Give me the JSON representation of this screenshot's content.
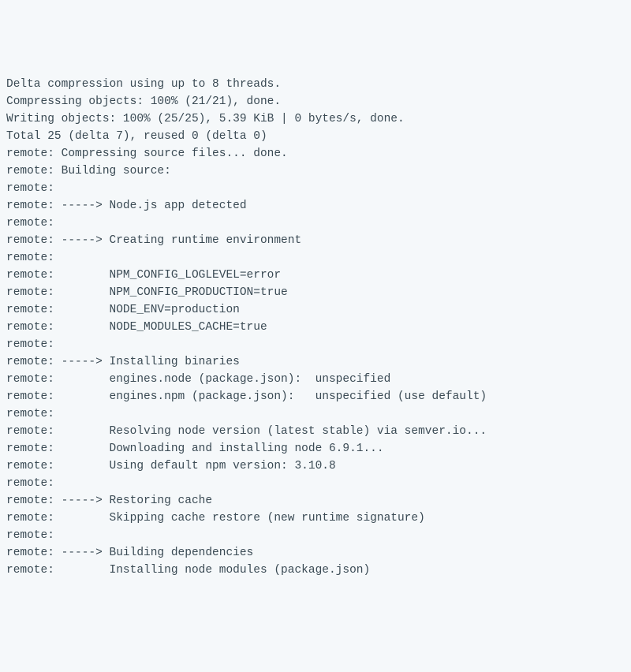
{
  "terminal": {
    "lines": [
      "Delta compression using up to 8 threads.",
      "Compressing objects: 100% (21/21), done.",
      "Writing objects: 100% (25/25), 5.39 KiB | 0 bytes/s, done.",
      "Total 25 (delta 7), reused 0 (delta 0)",
      "remote: Compressing source files... done.",
      "remote: Building source:",
      "remote:",
      "remote: -----> Node.js app detected",
      "remote:",
      "remote: -----> Creating runtime environment",
      "remote:",
      "remote:        NPM_CONFIG_LOGLEVEL=error",
      "remote:        NPM_CONFIG_PRODUCTION=true",
      "remote:        NODE_ENV=production",
      "remote:        NODE_MODULES_CACHE=true",
      "remote:",
      "remote: -----> Installing binaries",
      "remote:        engines.node (package.json):  unspecified",
      "remote:        engines.npm (package.json):   unspecified (use default)",
      "remote:",
      "remote:        Resolving node version (latest stable) via semver.io...",
      "remote:        Downloading and installing node 6.9.1...",
      "remote:        Using default npm version: 3.10.8",
      "remote:",
      "remote: -----> Restoring cache",
      "remote:        Skipping cache restore (new runtime signature)",
      "remote:",
      "remote: -----> Building dependencies",
      "remote:        Installing node modules (package.json)"
    ]
  }
}
